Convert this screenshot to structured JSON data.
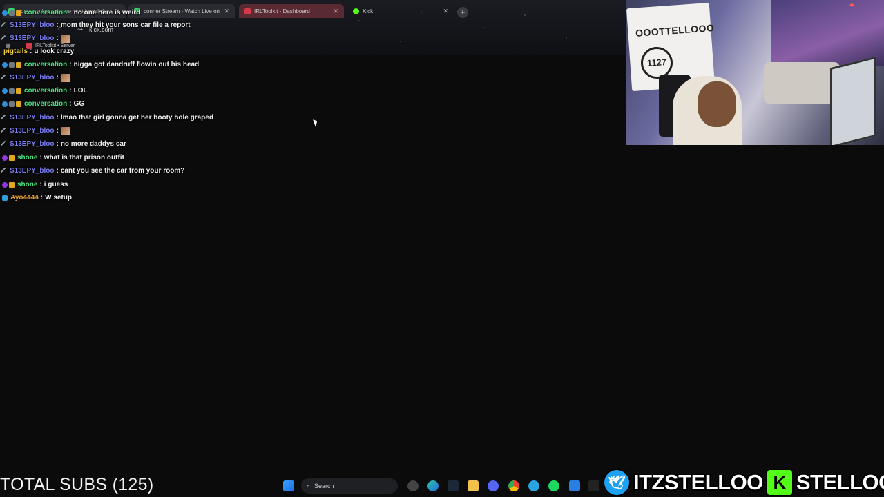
{
  "browser": {
    "tabs": [
      {
        "label": "conversation : no one here is weird",
        "color": "#39d46a"
      },
      {
        "label": "conner Stream - Watch Live on",
        "color": "#39d46a"
      },
      {
        "label": "IRLToolkit - Dashboard",
        "color": "#d63a4a"
      },
      {
        "label": "Kick",
        "color": "#53fc18"
      }
    ],
    "url": "kick.com",
    "bookmark": "IRLToolkit • Server"
  },
  "chat": {
    "messages": [
      {
        "user": "conversation",
        "user_color": "#4be07e",
        "text": "no one here is weird",
        "badges": [
          "blue",
          "sub",
          "gold"
        ]
      },
      {
        "user": "S13EPY_bloo",
        "user_color": "#7b7ff0",
        "text": "mom they hit your sons car file a report",
        "badges": [
          "sword"
        ]
      },
      {
        "user": "S13EPY_bloo",
        "user_color": "#7b7ff0",
        "text": "",
        "emote": true,
        "badges": [
          "sword"
        ]
      },
      {
        "user": "pigtails",
        "user_color": "#f2d13a",
        "text": "u look crazy",
        "badges": []
      },
      {
        "user": "conversation",
        "user_color": "#4be07e",
        "text": "nigga got dandruff flowin out his head",
        "badges": [
          "blue",
          "sub",
          "gold"
        ]
      },
      {
        "user": "S13EPY_bloo",
        "user_color": "#7b7ff0",
        "text": "",
        "emote": true,
        "badges": [
          "sword"
        ]
      },
      {
        "user": "conversation",
        "user_color": "#4be07e",
        "text": "LOL",
        "badges": [
          "blue",
          "sub",
          "gold"
        ]
      },
      {
        "user": "conversation",
        "user_color": "#4be07e",
        "text": "GG",
        "badges": [
          "blue",
          "sub",
          "gold"
        ]
      },
      {
        "user": "S13EPY_bloo",
        "user_color": "#7b7ff0",
        "text": "lmao that girl gonna get her booty hole graped",
        "badges": [
          "sword"
        ]
      },
      {
        "user": "S13EPY_bloo",
        "user_color": "#7b7ff0",
        "text": "",
        "emote": true,
        "badges": [
          "sword"
        ]
      },
      {
        "user": "S13EPY_bloo",
        "user_color": "#7b7ff0",
        "text": "no more daddys car",
        "badges": [
          "sword"
        ]
      },
      {
        "user": "shone",
        "user_color": "#4be07e",
        "text": "what is that prison outfit",
        "badges": [
          "purple",
          "gold"
        ]
      },
      {
        "user": "S13EPY_bloo",
        "user_color": "#7b7ff0",
        "text": "cant you see the car from your room?",
        "badges": [
          "sword"
        ]
      },
      {
        "user": "shone",
        "user_color": "#4be07e",
        "text": "i guess",
        "badges": [
          "purple",
          "gold"
        ]
      },
      {
        "user": "Ayo4444",
        "user_color": "#e8a23a",
        "text": "W setup",
        "badges": [
          "boost"
        ]
      }
    ]
  },
  "webcam": {
    "poster_text": "OOOTTELLOOO",
    "poster_badge": "1127"
  },
  "overlay": {
    "total_subs": "TOTAL SUBS (125)",
    "twitter_handle": "ITZSTELLOO",
    "kick_handle": "STELLOOO",
    "twitter_icon": "twitter-bird-icon",
    "kick_icon": "kick-k-icon"
  },
  "taskbar": {
    "search_placeholder": "Search",
    "icons": [
      "windows-start-icon",
      "search-icon",
      "task-view-icon",
      "settings-icon",
      "edge-icon",
      "steam-icon",
      "file-explorer-icon",
      "discord-icon",
      "chrome-icon",
      "telegram-icon",
      "spotify-icon",
      "tool-icon",
      "app-icon"
    ]
  },
  "colors": {
    "background": "#0b0b0c",
    "twitter": "#1da1f2",
    "kick": "#53fc18"
  }
}
